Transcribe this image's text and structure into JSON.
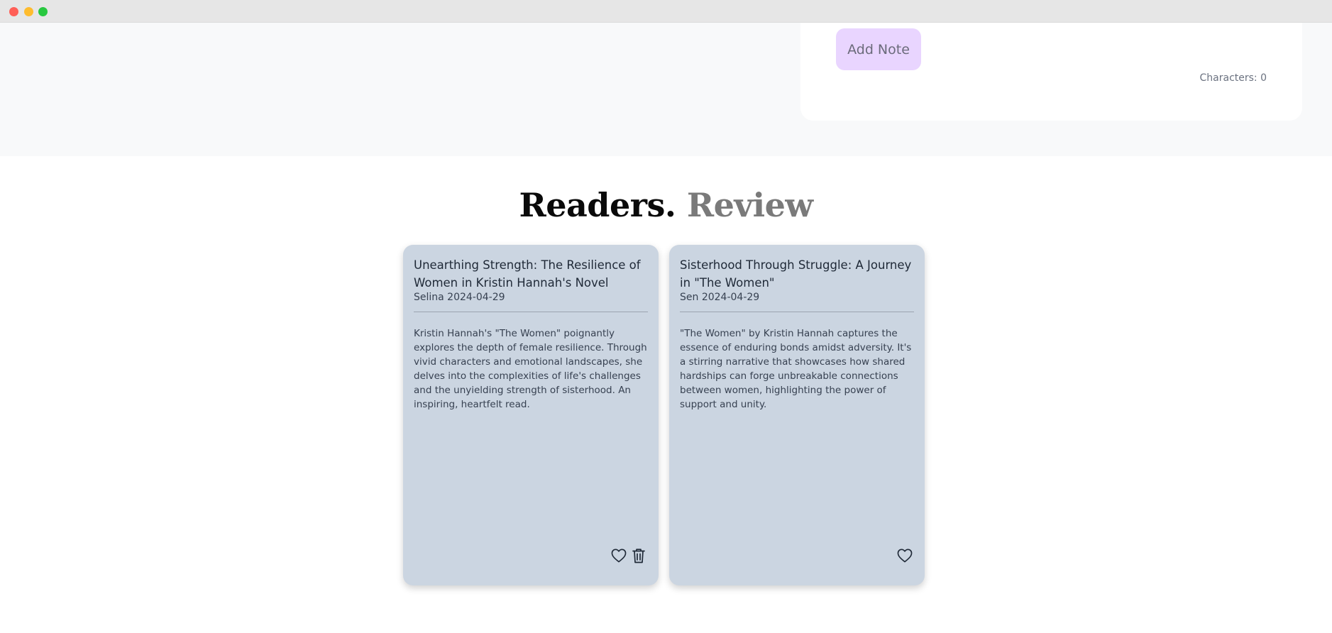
{
  "note_panel": {
    "add_note_label": "Add Note",
    "char_count": "Characters: 0"
  },
  "section": {
    "title_part1": "Readers.",
    "title_part2": "Review"
  },
  "reviews": [
    {
      "title": "Unearthing Strength: The Resilience of Women in Kristin Hannah's Novel",
      "meta": "Selina 2024-04-29",
      "body": "Kristin Hannah's \"The Women\" poignantly explores the depth of female resilience. Through vivid characters and emotional landscapes, she delves into the complexities of life's challenges and the unyielding strength of sisterhood. An inspiring, heartfelt read.",
      "actions": [
        "heart-icon",
        "trash-icon"
      ]
    },
    {
      "title": "Sisterhood Through Struggle: A Journey in \"The Women\"",
      "meta": "Sen 2024-04-29",
      "body": "\"The Women\" by Kristin Hannah captures the essence of enduring bonds amidst adversity. It's a stirring narrative that showcases how shared hardships can forge unbreakable connections between women, highlighting the power of support and unity.",
      "actions": [
        "heart-icon"
      ]
    }
  ],
  "colors": {
    "card_bg": "#cbd5e1",
    "button_bg": "#e9d5ff",
    "title_grey": "#7a7a7a"
  }
}
